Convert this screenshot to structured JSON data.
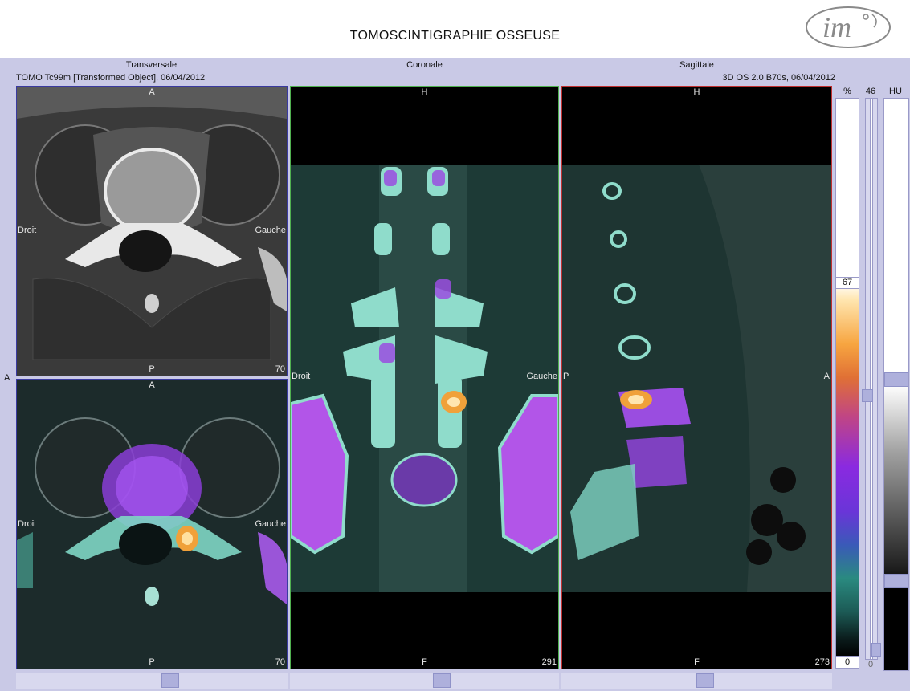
{
  "header": {
    "title": "TOMOSCINTIGRAPHIE OSSEUSE",
    "logo_text": "im"
  },
  "panels": {
    "transversal": {
      "title": "Transversale",
      "series_info": "TOMO Tc99m [Transformed Object], 06/04/2012"
    },
    "coronal": {
      "title": "Coronale"
    },
    "sagittal": {
      "title": "Sagittale",
      "series_info": "3D OS  2.0  B70s, 06/04/2012"
    }
  },
  "viewports": {
    "transversal_ct": {
      "top": "A",
      "bottom": "P",
      "left": "Droit",
      "right": "Gauche",
      "slice": "70"
    },
    "transversal_fused": {
      "top": "A",
      "bottom": "P",
      "left": "Droit",
      "right": "Gauche",
      "slice": "70"
    },
    "coronal_fused": {
      "top": "H",
      "bottom": "F",
      "left": "Droit",
      "right": "Gauche",
      "slice": "291"
    },
    "sagittal_fused": {
      "top": "H",
      "bottom": "F",
      "left": "P",
      "right": "A",
      "slice": "273"
    }
  },
  "edge_label_left": "A",
  "scales": {
    "percent": {
      "unit": "%",
      "max_value": "67",
      "min_value": "0"
    },
    "level": {
      "value_top": "46",
      "value_bottom": "0"
    },
    "hu": {
      "unit": "HU"
    }
  },
  "colors": {
    "background": "#c9c9e6",
    "viewport_blue": "#3a3aa0",
    "viewport_green": "#4fb04f",
    "viewport_red": "#c03030"
  }
}
